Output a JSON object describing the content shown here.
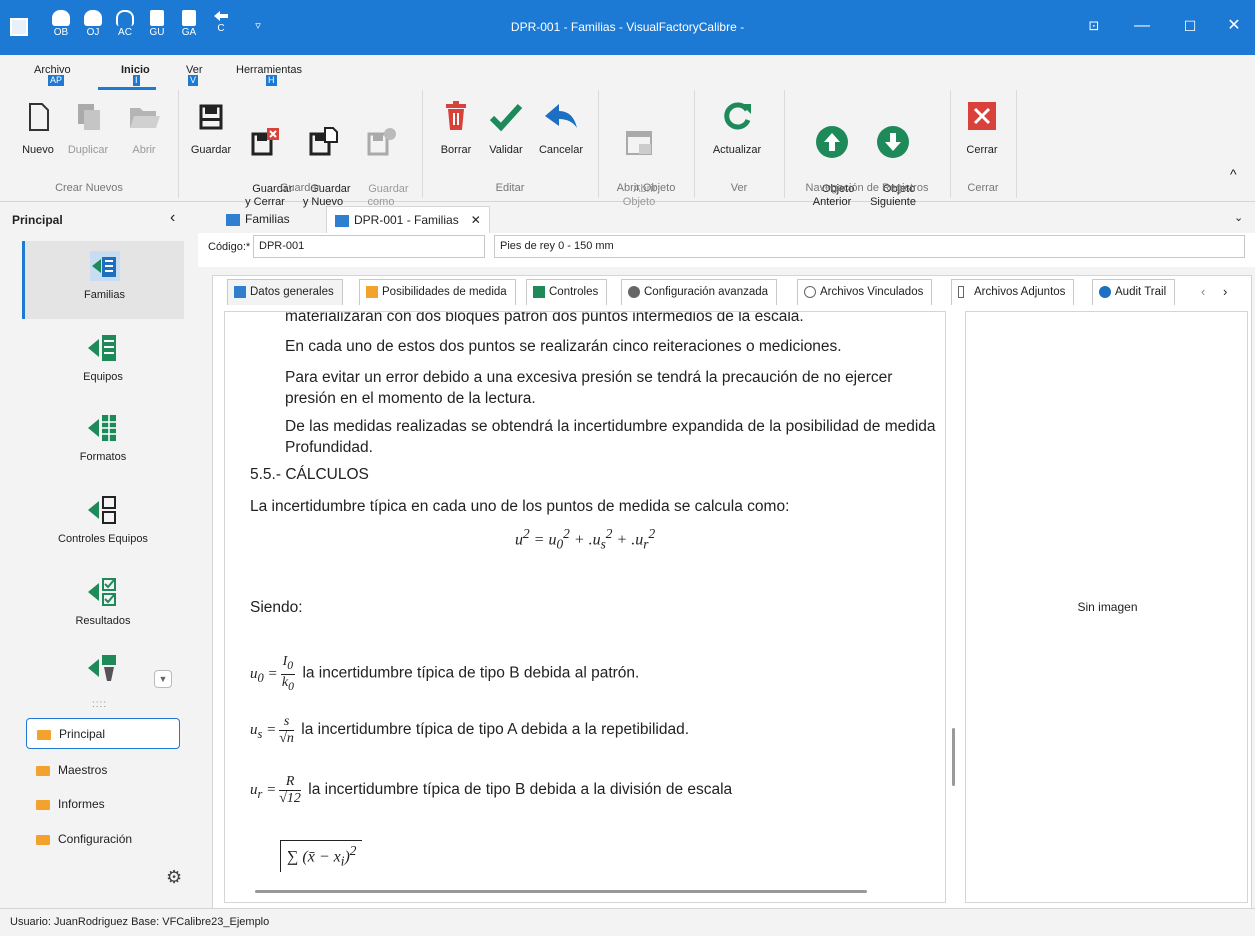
{
  "titlebar": {
    "title": "DPR-001 - Familias - VisualFactoryCalibre -",
    "qat": [
      "OB",
      "OJ",
      "AC",
      "GU",
      "GA",
      "C"
    ]
  },
  "menu": {
    "tabs": [
      {
        "label": "Archivo",
        "key": "AP"
      },
      {
        "label": "Inicio",
        "key": "I"
      },
      {
        "label": "Ver",
        "key": "V"
      },
      {
        "label": "Herramientas",
        "key": "H"
      }
    ]
  },
  "ribbon": {
    "nuevo": "Nuevo",
    "duplicar": "Duplicar",
    "abrir": "Abrir",
    "guardar": "Guardar",
    "guardar_cerrar": "Guardar\ny Cerrar",
    "guardar_nuevo": "Guardar\ny Nuevo",
    "guardar_como": "Guardar\ncomo",
    "borrar": "Borrar",
    "validar": "Validar",
    "cancelar": "Cancelar",
    "abrir_objeto": "Abrir\nObjeto",
    "actualizar": "Actualizar",
    "objeto_anterior": "Objeto\nAnterior",
    "objeto_siguiente": "Objeto\nSiguiente",
    "cerrar": "Cerrar",
    "groups": [
      "Crear Nuevos",
      "Guardar",
      "Editar",
      "Abrir Objeto",
      "Ver",
      "Navegación de Registros",
      "Cerrar"
    ]
  },
  "sidebar": {
    "header": "Principal",
    "items": [
      "Familias",
      "Equipos",
      "Formatos",
      "Controles Equipos",
      "Resultados"
    ],
    "nav": [
      "Principal",
      "Maestros",
      "Informes",
      "Configuración"
    ]
  },
  "doctabs": [
    "Familias",
    "DPR-001 - Familias"
  ],
  "fields": {
    "codigo_label": "Código:*",
    "codigo": "DPR-001",
    "descripcion": "Pies de rey 0 - 150 mm"
  },
  "innertabs": [
    "Datos generales",
    "Posibilidades de medida",
    "Controles",
    "Configuración avanzada",
    "Archivos Vinculados",
    "Archivos Adjuntos",
    "Audit Trail"
  ],
  "doc": {
    "p0": "materializarán con dos bloques patrón dos puntos intermedios de la escala.",
    "p1": "En cada uno de estos dos puntos se realizarán cinco reiteraciones o mediciones.",
    "p2": "Para evitar un error debido a una excesiva presión se tendrá la precaución de no ejercer presión en el momento de la lectura.",
    "p3": "De las medidas realizadas se obtendrá la incertidumbre expandida de la posibilidad de medida Profundidad.",
    "h1": "5.5.- CÁLCULOS",
    "p4": "La incertidumbre típica en cada uno de los puntos de medida se calcula como:",
    "siendo": "Siendo:",
    "u0": "la incertidumbre típica de tipo B debida al patrón.",
    "us": "la incertidumbre típica de tipo A debida a la repetibilidad.",
    "ur": "la incertidumbre típica de tipo B debida a la división de escala"
  },
  "image_panel": "Sin imagen",
  "status": "Usuario: JuanRodriguez  Base: VFCalibre23_Ejemplo"
}
